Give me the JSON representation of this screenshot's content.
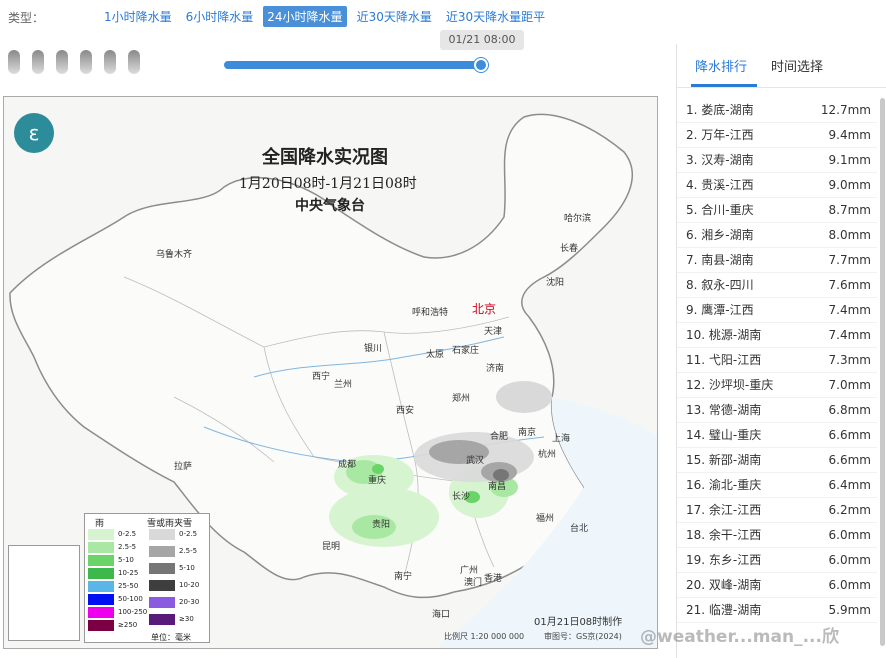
{
  "header": {
    "type_label": "类型：",
    "tabs": [
      {
        "label": "1小时降水量"
      },
      {
        "label": "6小时降水量"
      },
      {
        "label": "24小时降水量"
      },
      {
        "label": "近30天降水量"
      },
      {
        "label": "近30天降水量距平"
      }
    ],
    "active_tab": "24小时降水量"
  },
  "timeline": {
    "current_time": "01/21 08:00",
    "progress": 1.0
  },
  "map": {
    "title": "全国降水实况图",
    "subtitle": "1月20日08时-1月21日08时",
    "agency": "中央气象台",
    "made_at": "01月21日08时制作",
    "scale": "比例尺  1:20 000 000",
    "audit": "审图号：GS京(2024)",
    "cities": [
      {
        "name": "乌鲁木齐"
      },
      {
        "name": "哈尔滨"
      },
      {
        "name": "长春"
      },
      {
        "name": "沈阳"
      },
      {
        "name": "呼和浩特"
      },
      {
        "name": "北京"
      },
      {
        "name": "天津"
      },
      {
        "name": "银川"
      },
      {
        "name": "太原"
      },
      {
        "name": "石家庄"
      },
      {
        "name": "济南"
      },
      {
        "name": "西宁"
      },
      {
        "name": "兰州"
      },
      {
        "name": "郑州"
      },
      {
        "name": "西安"
      },
      {
        "name": "南京"
      },
      {
        "name": "合肥"
      },
      {
        "name": "上海"
      },
      {
        "name": "拉萨"
      },
      {
        "name": "成都"
      },
      {
        "name": "武汉"
      },
      {
        "name": "杭州"
      },
      {
        "name": "重庆"
      },
      {
        "name": "长沙"
      },
      {
        "name": "南昌"
      },
      {
        "name": "福州"
      },
      {
        "name": "贵阳"
      },
      {
        "name": "台北"
      },
      {
        "name": "昆明"
      },
      {
        "name": "南宁"
      },
      {
        "name": "广州"
      },
      {
        "name": "澳门"
      },
      {
        "name": "香港"
      },
      {
        "name": "海口"
      }
    ],
    "legend": {
      "rain_title": "雨",
      "snow_title": "雪或雨夹雪",
      "unit": "单位：毫米",
      "rain": [
        {
          "label": "0-2.5",
          "color": "#d7f4d0"
        },
        {
          "label": "2.5-5",
          "color": "#a9e8a3"
        },
        {
          "label": "5-10",
          "color": "#6bd468"
        },
        {
          "label": "10-25",
          "color": "#3cb94a"
        },
        {
          "label": "25-50",
          "color": "#5ab6e6"
        },
        {
          "label": "50-100",
          "color": "#0010f0"
        },
        {
          "label": "100-250",
          "color": "#ee00ee"
        },
        {
          "label": "≥250",
          "color": "#7b0043"
        }
      ],
      "snow": [
        {
          "label": "0-2.5",
          "color": "#d9d9d9"
        },
        {
          "label": "2.5-5",
          "color": "#a6a6a6"
        },
        {
          "label": "5-10",
          "color": "#767676"
        },
        {
          "label": "10-20",
          "color": "#3e3e3e"
        },
        {
          "label": "20-30",
          "color": "#8a5ae0"
        },
        {
          "label": "≥30",
          "color": "#5a1a7a"
        }
      ]
    }
  },
  "ranking": {
    "tabs": [
      {
        "label": "降水排行"
      },
      {
        "label": "时间选择"
      }
    ],
    "items": [
      {
        "label": "1. 娄底-湖南",
        "value": "12.7mm"
      },
      {
        "label": "2. 万年-江西",
        "value": "9.4mm"
      },
      {
        "label": "3. 汉寿-湖南",
        "value": "9.1mm"
      },
      {
        "label": "4. 贵溪-江西",
        "value": "9.0mm"
      },
      {
        "label": "5. 合川-重庆",
        "value": "8.7mm"
      },
      {
        "label": "6. 湘乡-湖南",
        "value": "8.0mm"
      },
      {
        "label": "7. 南县-湖南",
        "value": "7.7mm"
      },
      {
        "label": "8. 叙永-四川",
        "value": "7.6mm"
      },
      {
        "label": "9. 鹰潭-江西",
        "value": "7.4mm"
      },
      {
        "label": "10. 桃源-湖南",
        "value": "7.4mm"
      },
      {
        "label": "11. 弋阳-江西",
        "value": "7.3mm"
      },
      {
        "label": "12. 沙坪坝-重庆",
        "value": "7.0mm"
      },
      {
        "label": "13. 常德-湖南",
        "value": "6.8mm"
      },
      {
        "label": "14. 璧山-重庆",
        "value": "6.6mm"
      },
      {
        "label": "15. 新邵-湖南",
        "value": "6.6mm"
      },
      {
        "label": "16. 渝北-重庆",
        "value": "6.4mm"
      },
      {
        "label": "17. 余江-江西",
        "value": "6.2mm"
      },
      {
        "label": "18. 余干-江西",
        "value": "6.0mm"
      },
      {
        "label": "19. 东乡-江西",
        "value": "6.0mm"
      },
      {
        "label": "20. 双峰-湖南",
        "value": "6.0mm"
      },
      {
        "label": "21. 临澧-湖南",
        "value": "5.9mm"
      }
    ]
  },
  "watermark": "@weather...man_...欣"
}
